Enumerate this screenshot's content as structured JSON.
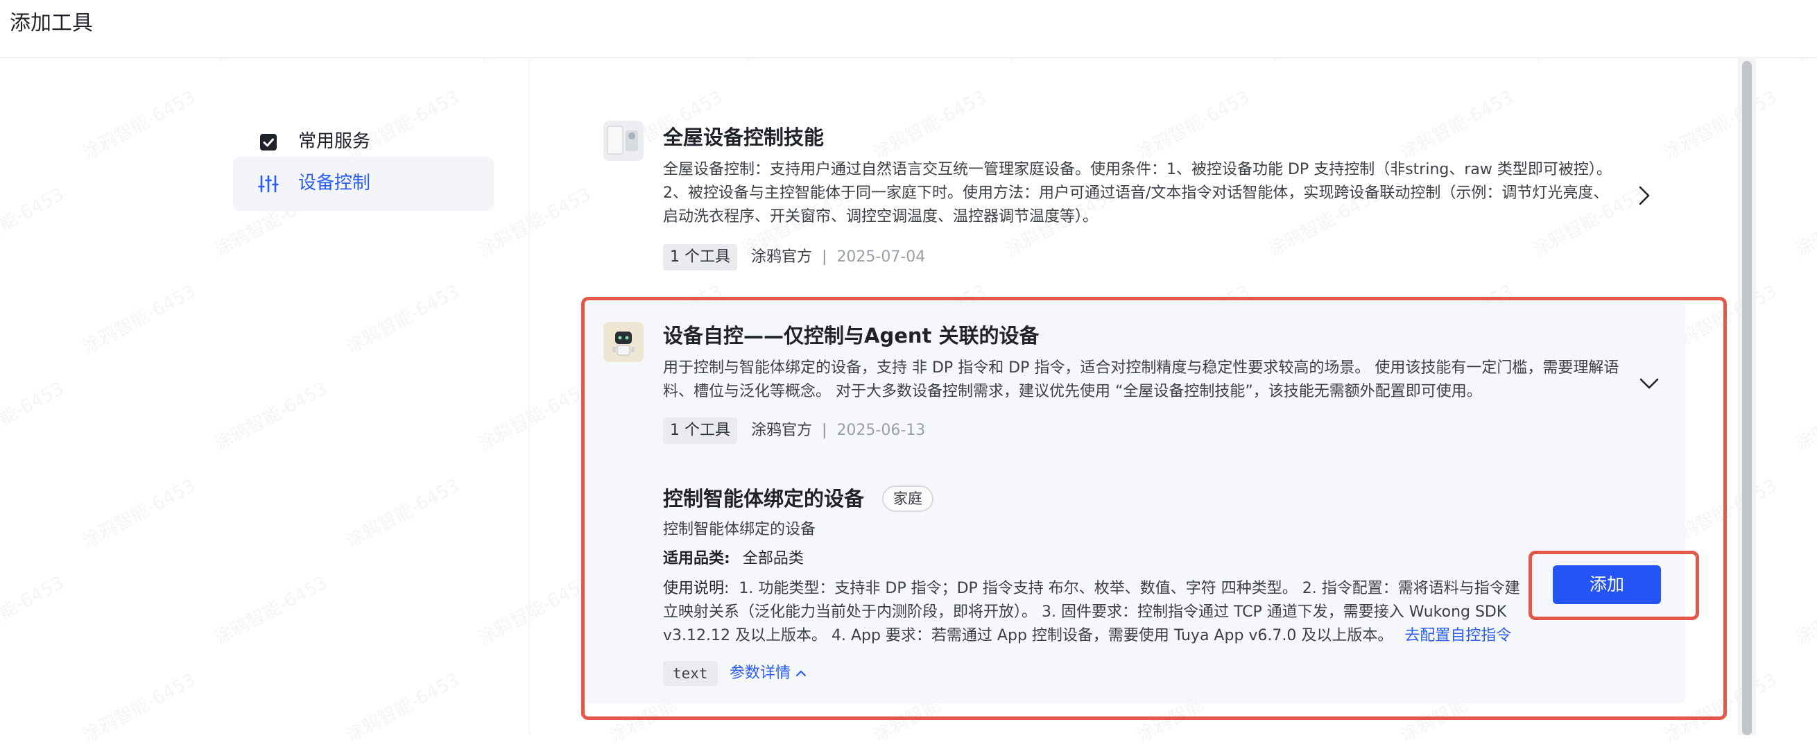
{
  "header": {
    "title": "添加工具"
  },
  "watermark": "涂鸦智能-6453",
  "sidebar": {
    "items": [
      {
        "label": "常用服务",
        "icon": "checkbox-icon",
        "active": false
      },
      {
        "label": "设备控制",
        "icon": "sliders-icon",
        "active": true
      }
    ]
  },
  "skills": [
    {
      "title": "全屋设备控制技能",
      "description": "全屋设备控制：支持用户通过自然语言交互统一管理家庭设备。使用条件：1、被控设备功能 DP 支持控制（非string、raw 类型即可被控）。2、被控设备与主控智能体于同一家庭下时。使用方法：用户可通过语音/文本指令对话智能体，实现跨设备联动控制（示例：调节灯光亮度、启动洗衣程序、开关窗帘、调控空调温度、温控器调节温度等）。",
      "tool_count": "1 个工具",
      "source": "涂鸦官方",
      "separator": "|",
      "date": "2025-07-04",
      "chevron": "chevron-right-icon"
    },
    {
      "title": "设备自控——仅控制与Agent 关联的设备",
      "description": "用于控制与智能体绑定的设备，支持 非 DP 指令和 DP 指令，适合对控制精度与稳定性要求较高的场景。 使用该技能有一定门槛，需要理解语料、槽位与泛化等概念。 对于大多数设备控制需求，建议优先使用 “全屋设备控制技能”，该技能无需额外配置即可使用。",
      "tool_count": "1 个工具",
      "source": "涂鸦官方",
      "separator": "|",
      "date": "2025-06-13",
      "chevron": "chevron-down-icon",
      "tool": {
        "title": "控制智能体绑定的设备",
        "badge": "家庭",
        "subtitle": "控制智能体绑定的设备",
        "category_label": "适用品类:",
        "category_value": "全部品类",
        "usage_label": "使用说明:",
        "usage_text": "1. 功能类型：支持非 DP 指令；DP 指令支持 布尔、枚举、数值、字符 四种类型。 2. 指令配置：需将语料与指令建立映射关系（泛化能力当前处于内测阶段，即将开放）。 3. 固件要求：控制指令通过 TCP 通道下发，需要接入 Wukong SDK v3.12.12 及以上版本。 4. App 要求：若需通过 App 控制设备，需要使用 Tuya App v6.7.0 及以上版本。",
        "config_link": "去配置自控指令",
        "param_type": "text",
        "param_link": "参数详情",
        "add_button": "添加"
      }
    }
  ],
  "colors": {
    "accent": "#2454f5",
    "highlight_border": "#e4574a",
    "card_bg": "#f6f7fa"
  }
}
